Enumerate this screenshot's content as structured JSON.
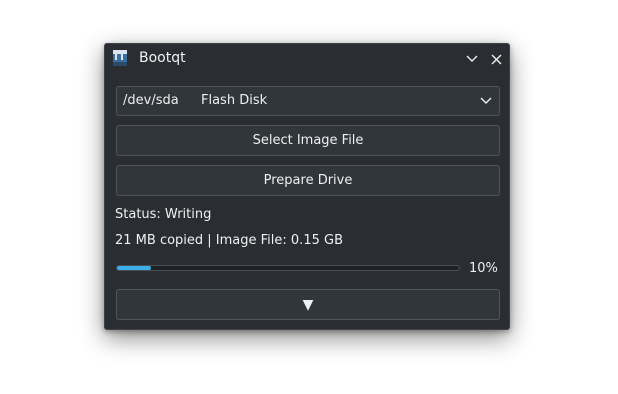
{
  "window": {
    "title": "Bootqt"
  },
  "device_select": {
    "device": "/dev/sda",
    "name": "Flash Disk"
  },
  "buttons": {
    "select_image": "Select Image File",
    "prepare_drive": "Prepare Drive",
    "toggle_details": "▼"
  },
  "status": {
    "text": "Status: Writing",
    "progress_text": "21 MB copied | Image File: 0.15 GB",
    "progress_percent": 10,
    "progress_label": "10%"
  },
  "icons": {
    "app": "bootqt-app-icon",
    "minimize": "chevron-down-icon",
    "close": "close-icon",
    "dropdown": "chevron-down-icon"
  },
  "colors": {
    "window_bg": "#2a2e32",
    "control_bg": "#31363b",
    "accent": "#3daee9",
    "text": "#eef0f1"
  }
}
